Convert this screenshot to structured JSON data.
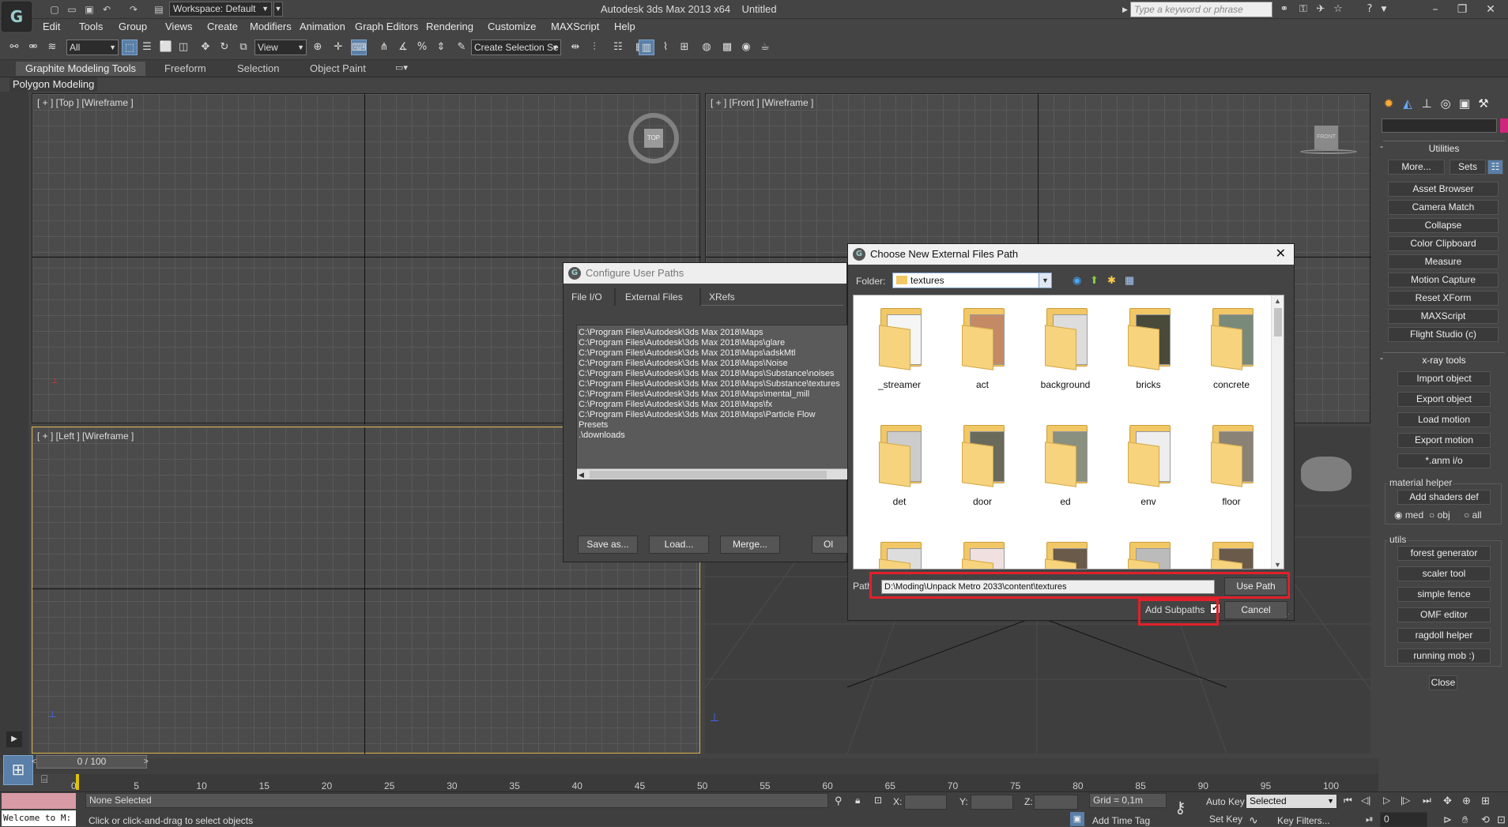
{
  "titlebar": {
    "app_logo": "3ds Max logo",
    "workspace_label": "Workspace: Default",
    "window_title": "Autodesk 3ds Max  2013 x64",
    "document_name": "Untitled",
    "search_placeholder": "Type a keyword or phrase"
  },
  "menu": [
    "Edit",
    "Tools",
    "Group",
    "Views",
    "Create",
    "Modifiers",
    "Animation",
    "Graph Editors",
    "Rendering",
    "Customize",
    "MAXScript",
    "Help"
  ],
  "toolbar": {
    "selection_filter": "All",
    "reference_coord": "View",
    "named_selection": "Create Selection Se"
  },
  "ribbon": {
    "tabs": [
      "Graphite Modeling Tools",
      "Freeform",
      "Selection",
      "Object Paint"
    ],
    "panel_label": "Polygon Modeling"
  },
  "viewports": {
    "top": "[ + ] [Top ] [Wireframe ]",
    "front": "[ + ] [Front ] [Wireframe ]",
    "left": "[ + ] [Left ] [Wireframe ]",
    "viewcube_top": "TOP",
    "viewcube_front": "FRONT"
  },
  "command_panel": {
    "utilities_header": "Utilities",
    "more_button": "More...",
    "sets_button": "Sets",
    "utility_buttons": [
      "Asset Browser",
      "Camera Match",
      "Collapse",
      "Color Clipboard",
      "Measure",
      "Motion Capture",
      "Reset XForm",
      "MAXScript",
      "Flight Studio (c)"
    ],
    "xray_header": "x-ray tools",
    "xray_buttons": [
      "Import object",
      "Export object",
      "Load motion",
      "Export motion",
      "*.anm i/o"
    ],
    "material_helper_label": "material helper",
    "add_shaders_button": "Add shaders def",
    "radio_options": [
      "med",
      "obj",
      "all"
    ],
    "utils_label": "utils",
    "utils_buttons": [
      "forest generator",
      "scaler tool",
      "simple fence",
      "OMF editor",
      "ragdoll helper",
      "running mob :)"
    ],
    "close_button": "Close"
  },
  "timeline": {
    "frame_counter": "0 / 100",
    "ticks": [
      "0",
      "5",
      "10",
      "15",
      "20",
      "25",
      "30",
      "35",
      "40",
      "45",
      "50",
      "55",
      "60",
      "65",
      "70",
      "75",
      "80",
      "85",
      "90",
      "95",
      "100"
    ]
  },
  "status": {
    "maxscript_listener": "Welcome to M:",
    "selection_status": "None Selected",
    "prompt": "Click or click-and-drag to select objects",
    "x_label": "X:",
    "y_label": "Y:",
    "z_label": "Z:",
    "grid": "Grid = 0,1m",
    "add_time_tag": "Add Time Tag",
    "auto_key": "Auto Key",
    "set_key": "Set Key",
    "key_mode": "Selected",
    "key_filters": "Key Filters...",
    "current_frame": "0"
  },
  "configure_dialog": {
    "title": "Configure User Paths",
    "tabs": [
      "File I/O",
      "External Files",
      "XRefs"
    ],
    "paths": [
      "C:\\Program Files\\Autodesk\\3ds Max 2018\\Maps",
      "C:\\Program Files\\Autodesk\\3ds Max 2018\\Maps\\glare",
      "C:\\Program Files\\Autodesk\\3ds Max 2018\\Maps\\adskMtl",
      "C:\\Program Files\\Autodesk\\3ds Max 2018\\Maps\\Noise",
      "C:\\Program Files\\Autodesk\\3ds Max 2018\\Maps\\Substance\\noises",
      "C:\\Program Files\\Autodesk\\3ds Max 2018\\Maps\\Substance\\textures",
      "C:\\Program Files\\Autodesk\\3ds Max 2018\\Maps\\mental_mill",
      "C:\\Program Files\\Autodesk\\3ds Max 2018\\Maps\\fx",
      "C:\\Program Files\\Autodesk\\3ds Max 2018\\Maps\\Particle Flow Presets",
      ".\\downloads"
    ],
    "save_as": "Save as...",
    "load": "Load...",
    "merge": "Merge...",
    "ok_partial": "Ol"
  },
  "choose_dialog": {
    "title": "Choose New External Files Path",
    "folder_label": "Folder:",
    "folder_value": "textures",
    "folders": [
      "_streamer",
      "act",
      "background",
      "bricks",
      "concrete",
      "det",
      "door",
      "ed",
      "env",
      "floor",
      "",
      "",
      "",
      "",
      ""
    ],
    "path_label": "Path",
    "path_value": "D:\\Moding\\Unpack Metro 2033\\content\\textures",
    "use_path": "Use Path",
    "add_subpaths": "Add Subpaths",
    "add_subpaths_checked": true,
    "cancel": "Cancel"
  },
  "colors": {
    "highlight": "#e0202a",
    "active_viewport_border": "#d9b24a",
    "ui_background": "#444444"
  }
}
